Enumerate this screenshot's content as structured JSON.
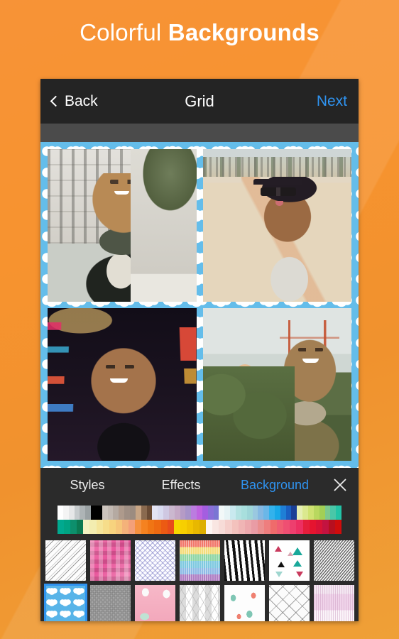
{
  "promo": {
    "title_light": "Colorful ",
    "title_bold": "Backgrounds",
    "bg_color": "#f2912f"
  },
  "navbar": {
    "back_label": "Back",
    "title": "Grid",
    "next_label": "Next",
    "next_color": "#2f93f0",
    "bg_color": "#242424"
  },
  "collage": {
    "background_pattern": "blue-clouds",
    "background_color": "#64bdea",
    "photos": [
      {
        "name": "photo-venice-selfie",
        "caption": "Woman in dark coat and green scarf in front of stone palace"
      },
      {
        "name": "photo-beach-selfie",
        "caption": "Woman with black cap and sunglasses on beach, tongue out"
      },
      {
        "name": "photo-night-city-selfie",
        "caption": "Woman smiling with neon city lights at night"
      },
      {
        "name": "photo-golden-gate-selfie",
        "caption": "Woman waving in front of the Golden Gate Bridge"
      }
    ]
  },
  "tabs": [
    {
      "label": "Styles",
      "active": false
    },
    {
      "label": "Effects",
      "active": false
    },
    {
      "label": "Background",
      "active": true
    }
  ],
  "close_icon": "close-icon",
  "palette": {
    "row1": [
      "#ffffff",
      "#f4f4f4",
      "#e6e7e8",
      "#c6cbcd",
      "#aeb4b6",
      "#9aa1a3",
      "#000000",
      "#000000",
      "#ccc4bd",
      "#c2b9b2",
      "#b5aaa2",
      "#ae9a8c",
      "#a08f84",
      "#9c8c80",
      "#c8a584",
      "#8a6a4f",
      "#6b4c35",
      "#e3e4f4",
      "#d9dbf0",
      "#cfc8e2",
      "#cbb8cf",
      "#c5a9c6",
      "#b59bc6",
      "#a793c9",
      "#bb7ce0",
      "#bf63e0",
      "#a45ee0",
      "#8a6fd8",
      "#7a76d3",
      "#f2f8f8",
      "#e6f3f5",
      "#c9e9ef",
      "#b4e2e2",
      "#a8dfdd",
      "#9ed6d8",
      "#9ac8e0",
      "#85b8e2",
      "#6ab7e8",
      "#33b2ec",
      "#19a8e8",
      "#1f7fd6",
      "#1b5fc2",
      "#1b3f96",
      "#e6efb4",
      "#dbe98f",
      "#cfe271",
      "#b9d85f",
      "#a2cf55",
      "#7cc98e",
      "#4ac7a8",
      "#22c3a6"
    ],
    "row2": [
      "#00a98f",
      "#00a383",
      "#0d8f6c",
      "#0b7a52",
      "#f4f2c2",
      "#f3edb0",
      "#f5e59a",
      "#f6dd8a",
      "#f7d37e",
      "#f6c67a",
      "#f4b27a",
      "#f3a07a",
      "#f5913f",
      "#f58220",
      "#f07514",
      "#ee6a11",
      "#ec5a13",
      "#e84c1b",
      "#f6d800",
      "#f7cf00",
      "#f2c400",
      "#e8b800",
      "#ddae00",
      "#fdf5f2",
      "#f9e6e2",
      "#f7dcd8",
      "#f5cfcb",
      "#f3c2bd",
      "#f0b5b5",
      "#eda9ad",
      "#e99ca5",
      "#ea8f8f",
      "#ee7e7e",
      "#ef6b6b",
      "#f05d72",
      "#ef4f72",
      "#ed3f6e",
      "#ec2f62",
      "#e51e3c",
      "#e5142f",
      "#d81235",
      "#c31340",
      "#b70f1f",
      "#d00c0c"
    ]
  },
  "patterns": {
    "row1": [
      {
        "name": "pattern-white-diagonal-dots",
        "selected": false
      },
      {
        "name": "pattern-pink-check",
        "selected": false
      },
      {
        "name": "pattern-purple-geometric",
        "selected": false
      },
      {
        "name": "pattern-rainbow-stripes",
        "selected": false
      },
      {
        "name": "pattern-zebra",
        "selected": false
      },
      {
        "name": "pattern-triangles",
        "selected": false
      },
      {
        "name": "pattern-gray-diagonal",
        "selected": false
      }
    ],
    "row2": [
      {
        "name": "pattern-blue-clouds",
        "selected": true
      },
      {
        "name": "pattern-gray-scallop",
        "selected": false
      },
      {
        "name": "pattern-pink-bunny",
        "selected": false
      },
      {
        "name": "pattern-white-triangles-3d",
        "selected": false
      },
      {
        "name": "pattern-hot-air-balloons",
        "selected": false
      },
      {
        "name": "pattern-diamond-grid",
        "selected": false
      },
      {
        "name": "pattern-pink-drip",
        "selected": false
      }
    ]
  }
}
